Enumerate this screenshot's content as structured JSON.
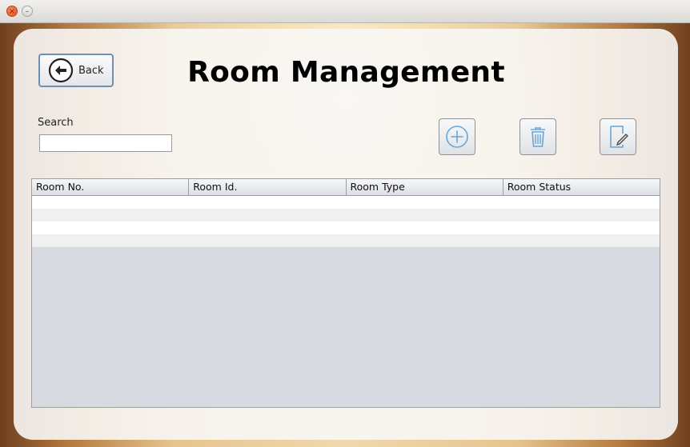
{
  "window": {
    "close_glyph": "×",
    "minimize_glyph": "–"
  },
  "header": {
    "back_label": "Back",
    "title": "Room Management"
  },
  "search": {
    "label": "Search",
    "value": "",
    "placeholder": ""
  },
  "toolbar": {
    "add_icon": "plus-circle-icon",
    "delete_icon": "trash-icon",
    "edit_icon": "edit-document-icon",
    "icon_color": "#6aa6d6"
  },
  "table": {
    "columns": [
      "Room No.",
      "Room Id.",
      "Room Type",
      "Room Status"
    ],
    "rows": [
      [
        "",
        "",
        "",
        ""
      ],
      [
        "",
        "",
        "",
        ""
      ],
      [
        "",
        "",
        "",
        ""
      ],
      [
        "",
        "",
        "",
        ""
      ]
    ]
  }
}
